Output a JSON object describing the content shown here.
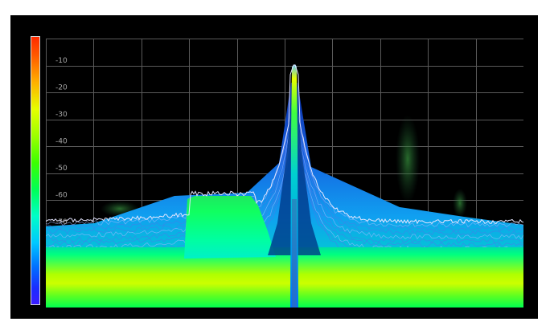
{
  "spectrum_view": {
    "amplitude_ticks": [
      "-10",
      "-20",
      "-30",
      "-40",
      "-50",
      "-60",
      "-70"
    ]
  },
  "colors": {
    "background": "#000000",
    "grid": "#5a5a5a",
    "tick_label": "#a9a9a9"
  }
}
